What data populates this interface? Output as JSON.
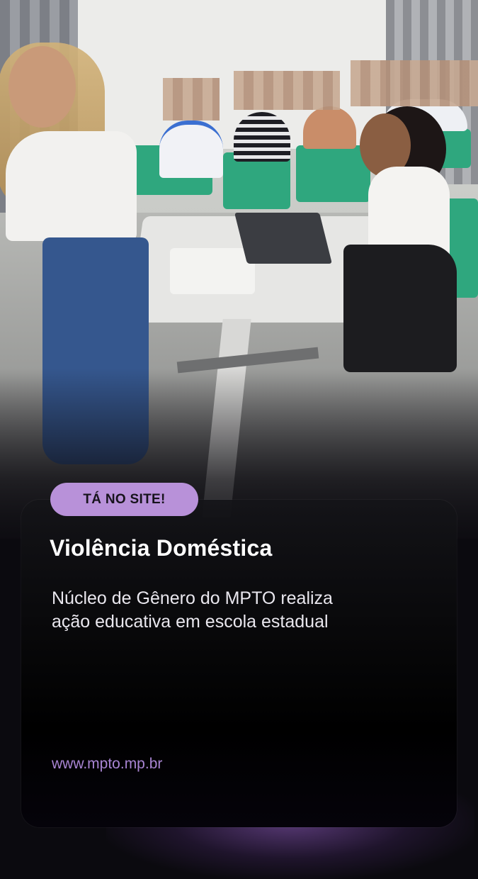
{
  "photo": {
    "description_icon": "classroom-photo"
  },
  "badge": {
    "label": "TÁ NO SITE!"
  },
  "headline": "Violência Doméstica",
  "subtitle": "Núcleo de Gênero do MPTO realiza ação educativa em escola estadual",
  "url": "www.mpto.mp.br",
  "colors": {
    "badge_bg": "#b891d9",
    "url": "#a985d3",
    "card_bg": "#000000",
    "text": "#ffffff"
  }
}
